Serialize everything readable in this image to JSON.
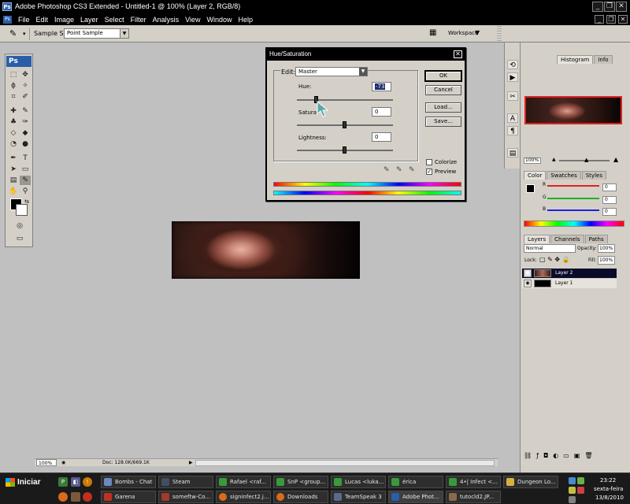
{
  "window": {
    "title": "Adobe Photoshop CS3 Extended - Untitled-1 @ 100% (Layer 2, RGB/8)",
    "badge": "Ps",
    "controls": [
      "_",
      "❐",
      "✕"
    ]
  },
  "menubar": {
    "items": [
      "File",
      "Edit",
      "Image",
      "Layer",
      "Select",
      "Filter",
      "Analysis",
      "View",
      "Window",
      "Help"
    ],
    "doc_controls": [
      "_",
      "❐",
      "✕"
    ]
  },
  "options": {
    "sample_size_label": "Sample Size:",
    "sample_size_value": "Point Sample",
    "workspace_label": "Workspace"
  },
  "status": {
    "zoom": "100%",
    "doc": "Doc: 128.0K/669.1K"
  },
  "tools": {
    "logo": "Ps"
  },
  "panels": {
    "navigator_tabs": [
      "Histogram",
      "Info"
    ],
    "navigator_zoom": "100%",
    "color_tabs": [
      "Color",
      "Swatches",
      "Styles"
    ],
    "channels": [
      {
        "label": "R",
        "value": "0",
        "color": "#e02020"
      },
      {
        "label": "G",
        "value": "0",
        "color": "#20b020"
      },
      {
        "label": "B",
        "value": "0",
        "color": "#2020e0"
      }
    ],
    "layers_tabs": [
      "Layers",
      "Channels",
      "Paths"
    ],
    "blend_mode": "Normal",
    "opacity_label": "Opacity:",
    "opacity_value": "100%",
    "lock_label": "Lock:",
    "fill_label": "Fill:",
    "fill_value": "100%",
    "layers": [
      {
        "name": "Layer 2",
        "selected": true
      },
      {
        "name": "Layer 1",
        "selected": false
      }
    ]
  },
  "dialog": {
    "title": "Hue/Saturation",
    "edit_label": "Edit:",
    "edit_value": "Master",
    "hue_label": "Hue:",
    "hue_value": "-73",
    "saturation_label": "Saturat",
    "saturation_value": "0",
    "lightness_label": "Lightness:",
    "lightness_value": "0",
    "ok": "OK",
    "cancel": "Cancel",
    "load": "Load...",
    "save": "Save...",
    "colorize_label": "Colorize",
    "colorize_checked": false,
    "preview_label": "Preview",
    "preview_checked": true
  },
  "taskbar": {
    "start_label": "Iniciar",
    "row1": [
      "Bombs - Chat",
      "Steam",
      "Rafael <raf...",
      "SnP <group...",
      "Lucas <luka...",
      "érica",
      "4•| Infect <...",
      "Dungeon Lo..."
    ],
    "row2": [
      "Garena",
      "someftw-Co...",
      "signinfect2.j...",
      "Downloads",
      "TeamSpeak 3",
      "Adobe Phot...",
      "tutocld2.JP..."
    ],
    "clock_time": "23:22",
    "clock_day": "sexta-feira",
    "clock_date": "13/8/2010"
  }
}
